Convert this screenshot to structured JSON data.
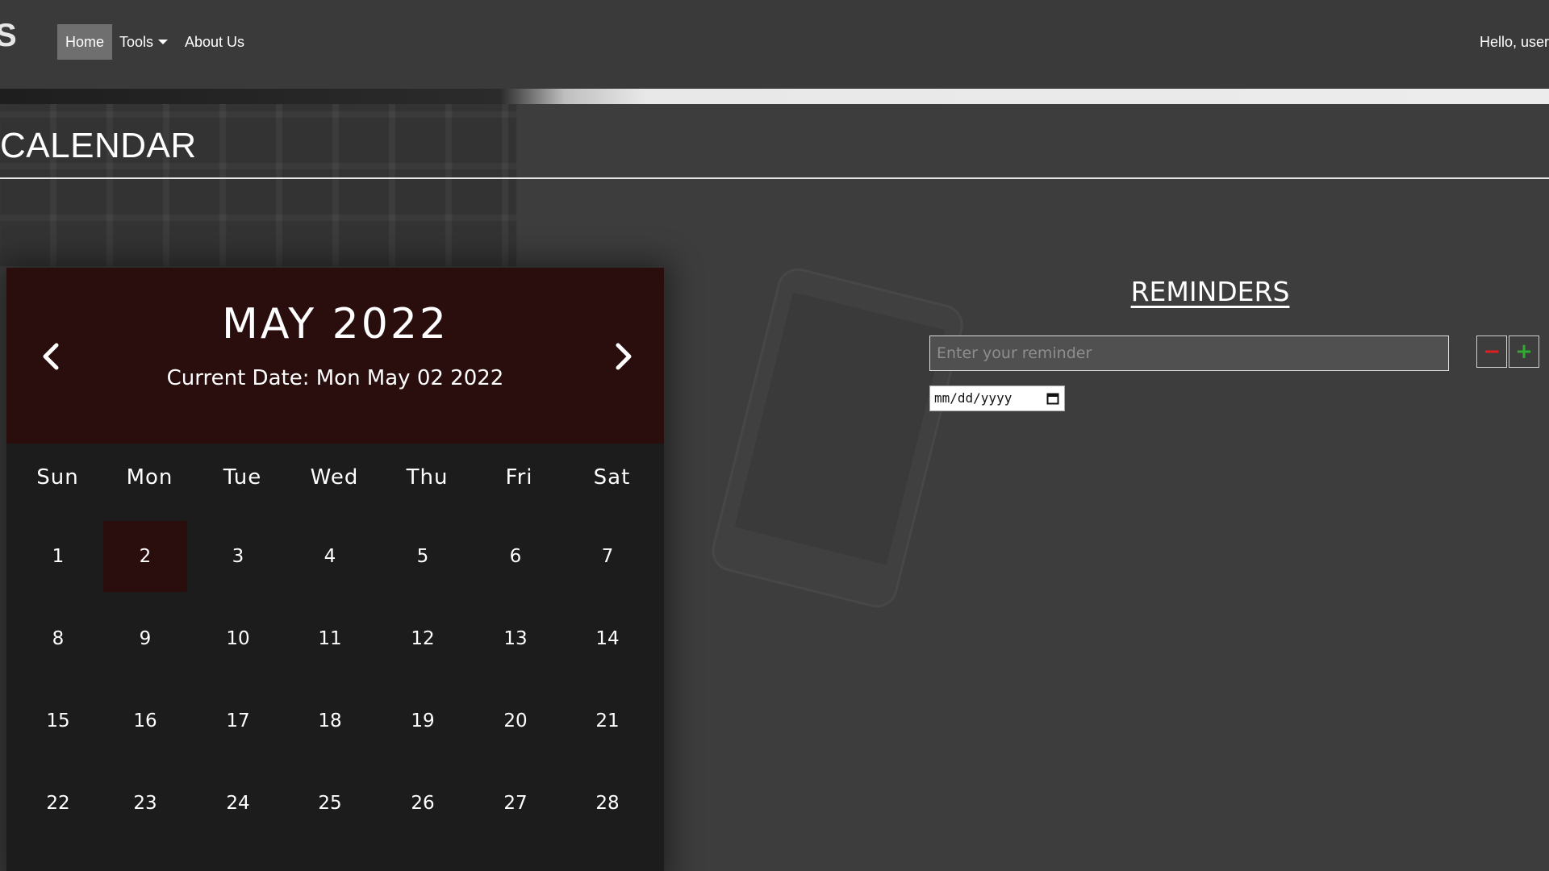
{
  "navbar": {
    "logo_char": "S",
    "items": [
      {
        "label": "Home"
      },
      {
        "label": "Tools"
      },
      {
        "label": "About Us"
      }
    ],
    "greeting": "Hello, user"
  },
  "page": {
    "title": "CALENDAR"
  },
  "calendar": {
    "month_title": "MAY 2022",
    "current_date_text": "Current Date: Mon May 02 2022",
    "weekdays": [
      "Sun",
      "Mon",
      "Tue",
      "Wed",
      "Thu",
      "Fri",
      "Sat"
    ],
    "days": [
      [
        "1",
        "2",
        "3",
        "4",
        "5",
        "6",
        "7"
      ],
      [
        "8",
        "9",
        "10",
        "11",
        "12",
        "13",
        "14"
      ],
      [
        "15",
        "16",
        "17",
        "18",
        "19",
        "20",
        "21"
      ],
      [
        "22",
        "23",
        "24",
        "25",
        "26",
        "27",
        "28"
      ]
    ],
    "today": "2",
    "prev_icon": "chevron-left-icon",
    "next_icon": "chevron-right-icon",
    "colors": {
      "header_bg": "#2a0e0e",
      "body_bg": "#1c1c1c",
      "today_bg": "#2a0e0e"
    }
  },
  "reminders": {
    "heading": "REMINDERS",
    "input_placeholder": "Enter your reminder",
    "input_value": "",
    "remove_button_glyph": "−",
    "add_button_glyph": "+",
    "date_placeholder": "mm/dd/yyyy",
    "colors": {
      "remove": "#e02020",
      "add": "#33aa33"
    }
  }
}
